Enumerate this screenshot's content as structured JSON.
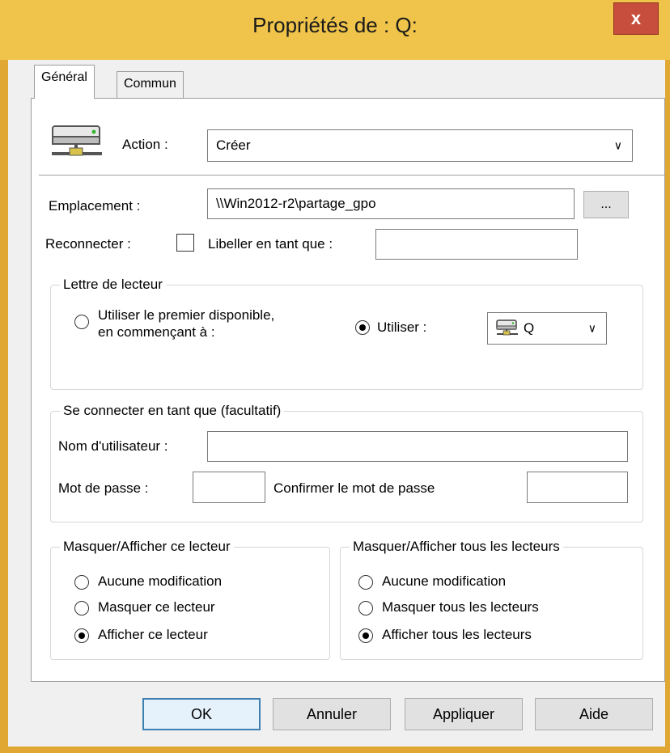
{
  "window": {
    "title": "Propriétés de : Q:",
    "close": "x"
  },
  "tabs": [
    {
      "label": "Général"
    },
    {
      "label": "Commun"
    }
  ],
  "action": {
    "label": "Action :",
    "value": "Créer"
  },
  "location": {
    "label": "Emplacement :",
    "value": "\\\\Win2012-r2\\partage_gpo",
    "browse": "..."
  },
  "reconnect": {
    "label": "Reconnecter :",
    "checked": false,
    "tag_label": "Libeller en tant que :",
    "tag_value": ""
  },
  "drive_letter": {
    "legend": "Lettre de lecteur",
    "option_first_line1": "Utiliser le premier disponible,",
    "option_first_line2": "en commençant à :",
    "option_use": "Utiliser :",
    "selected": "use",
    "drive_value": "Q"
  },
  "connect_as": {
    "legend": "Se connecter en tant que (facultatif)",
    "username_label": "Nom d'utilisateur :",
    "username_value": "",
    "password_label": "Mot de passe :",
    "password_value": "",
    "confirm_label": "Confirmer le mot de passe",
    "confirm_value": ""
  },
  "hide_show_drive": {
    "legend": "Masquer/Afficher ce lecteur",
    "options": [
      "Aucune modification",
      "Masquer ce lecteur",
      "Afficher ce lecteur"
    ],
    "selected_index": 2
  },
  "hide_show_all": {
    "legend": "Masquer/Afficher tous les lecteurs",
    "options": [
      "Aucune modification",
      "Masquer tous les lecteurs",
      "Afficher tous les lecteurs"
    ],
    "selected_index": 2
  },
  "buttons": {
    "ok": "OK",
    "cancel": "Annuler",
    "apply": "Appliquer",
    "help": "Aide"
  }
}
